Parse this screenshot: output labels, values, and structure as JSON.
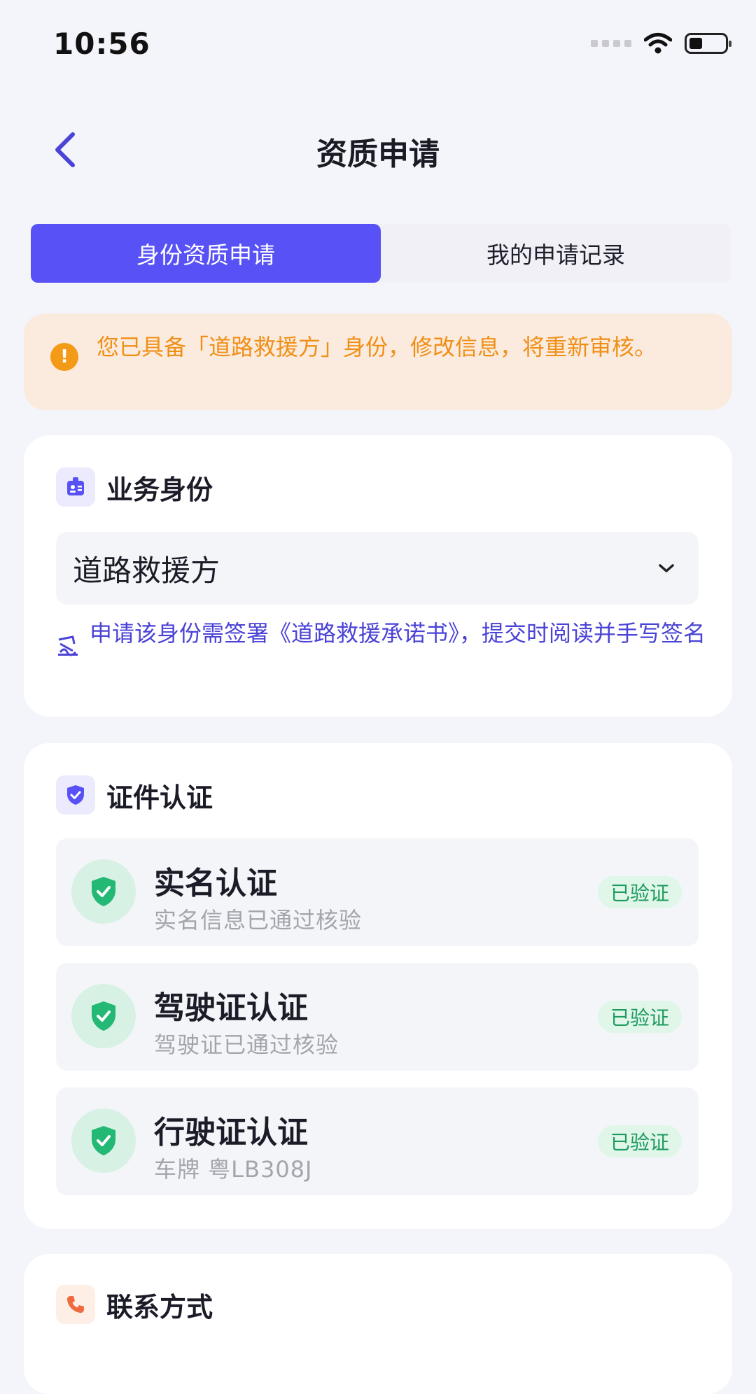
{
  "status_bar": {
    "time": "10:56"
  },
  "nav": {
    "title": "资质申请",
    "back_icon": "chevron-left-icon"
  },
  "tabs": [
    {
      "label": "身份资质申请",
      "active": true
    },
    {
      "label": "我的申请记录",
      "active": false
    }
  ],
  "notice": {
    "text": "您已具备「道路救援方」身份，修改信息，将重新审核。",
    "icon": "info-icon"
  },
  "business_identity": {
    "title": "业务身份",
    "icon": "id-badge-icon",
    "selected_value": "道路救援方",
    "hint": "申请该身份需签署《道路救援承诺书》，提交时阅读并手写签名"
  },
  "certification": {
    "title": "证件认证",
    "icon": "shield-check-icon",
    "items": [
      {
        "title": "实名认证",
        "subtitle": "实名信息已通过核验",
        "badge": "已验证"
      },
      {
        "title": "驾驶证认证",
        "subtitle": "驾驶证已通过核验",
        "badge": "已验证"
      },
      {
        "title": "行驶证认证",
        "subtitle": "车牌 粤LB308J",
        "badge": "已验证"
      }
    ]
  },
  "contact": {
    "title": "联系方式",
    "icon": "phone-icon"
  },
  "colors": {
    "primary": "#5852f6",
    "warning": "#f39a16",
    "success": "#1d9a5c",
    "contact_accent": "#ef6a3c"
  }
}
